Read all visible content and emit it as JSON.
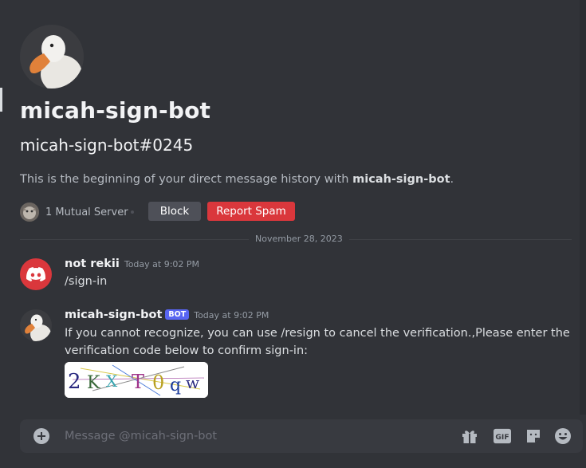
{
  "profile": {
    "name": "micah-sign-bot",
    "tag": "micah-sign-bot#0245",
    "intro_prefix": "This is the beginning of your direct message history with ",
    "intro_name": "micah-sign-bot",
    "intro_suffix": "."
  },
  "mutual": {
    "label": "1 Mutual Server"
  },
  "actions": {
    "block_label": "Block",
    "report_label": "Report Spam"
  },
  "divider": {
    "date": "November 28, 2023"
  },
  "messages": [
    {
      "author": "not rekii",
      "timestamp": "Today at 9:02 PM",
      "text": "/sign-in"
    },
    {
      "author": "micah-sign-bot",
      "badge": "BOT",
      "timestamp": "Today at 9:02 PM",
      "line1": "If you cannot recognize, you can use /resign to cancel the verification.,Please enter the",
      "line2": "verification code below to confirm sign-in:",
      "captcha_text": "2KXT0qw"
    }
  ],
  "composer": {
    "placeholder": "Message @micah-sign-bot"
  },
  "colors": {
    "background": "#313338",
    "accent": "#5865f2",
    "danger": "#da373c",
    "composer": "#383a40"
  },
  "icons": [
    "duck-avatar",
    "server-icon",
    "discord-logo-icon",
    "add-icon",
    "gift-icon",
    "gif-icon",
    "sticker-icon",
    "emoji-icon"
  ]
}
